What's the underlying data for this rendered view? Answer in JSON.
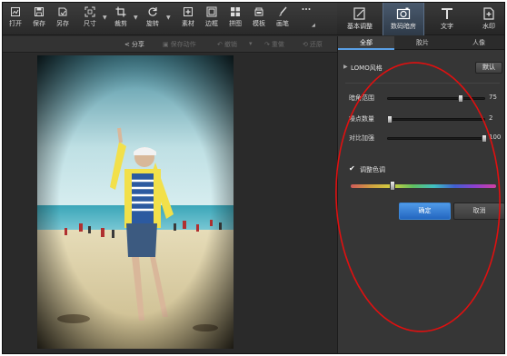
{
  "toolbar": {
    "items": [
      {
        "label": "打开",
        "icon": "open-image-icon"
      },
      {
        "label": "保存",
        "icon": "save-icon"
      },
      {
        "label": "另存",
        "icon": "save-as-icon"
      },
      {
        "label": "尺寸",
        "icon": "resize-icon"
      },
      {
        "label": "裁剪",
        "icon": "crop-icon"
      },
      {
        "label": "旋转",
        "icon": "rotate-icon"
      },
      {
        "label": "素材",
        "icon": "sticker-icon"
      },
      {
        "label": "边框",
        "icon": "frame-icon"
      },
      {
        "label": "拼图",
        "icon": "collage-icon"
      },
      {
        "label": "模板",
        "icon": "template-icon"
      },
      {
        "label": "画笔",
        "icon": "brush-icon"
      },
      {
        "label": "",
        "icon": "more-icon"
      }
    ]
  },
  "right_tabs": [
    {
      "label": "基本调整",
      "icon": "adjust-icon"
    },
    {
      "label": "数码暗房",
      "icon": "darkroom-camera-icon"
    },
    {
      "label": "文字",
      "icon": "text-icon"
    },
    {
      "label": "水印",
      "icon": "watermark-icon"
    }
  ],
  "action_bar": {
    "share": "分享",
    "save_action": "保存动作",
    "undo": "撤销",
    "redo": "重做",
    "restore": "还原"
  },
  "panel": {
    "tabs": [
      "全部",
      "胶片",
      "人像"
    ],
    "style_name": "LOMO风格",
    "default_button": "默认",
    "sliders": [
      {
        "label": "暗角范围",
        "value": "75",
        "level": 0.75
      },
      {
        "label": "噪点数量",
        "value": "2",
        "level": 0.02
      },
      {
        "label": "对比加强",
        "value": "100",
        "level": 1.0
      }
    ],
    "tint_checkbox": "调整色调",
    "tint_checked": true,
    "hue_level": 0.29,
    "ok_button": "确定",
    "cancel_button": "取消"
  },
  "colors": {
    "accent": "#3b86d8",
    "annotation": "#e01010",
    "background": "#2c2c2c"
  }
}
